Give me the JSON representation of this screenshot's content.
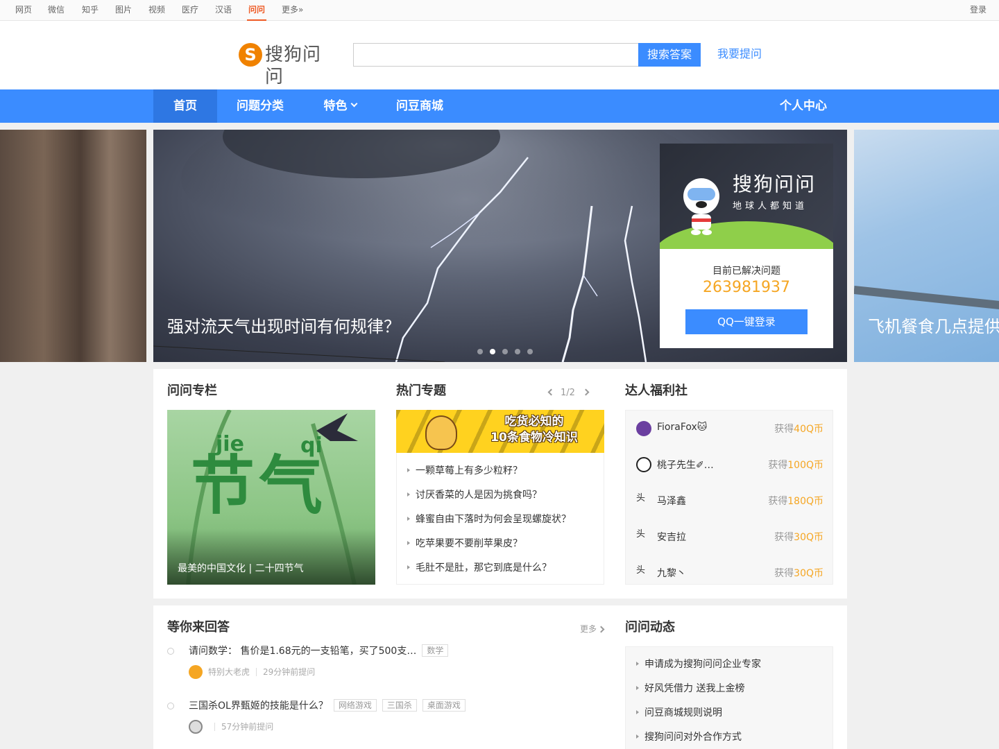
{
  "topbar": {
    "tabs": [
      "网页",
      "微信",
      "知乎",
      "图片",
      "视频",
      "医疗",
      "汉语",
      "问问",
      "更多»"
    ],
    "active_tab": "问问",
    "login": "登录"
  },
  "header": {
    "logo_text": "搜狗问问",
    "logo_mark": "S",
    "search_placeholder": "",
    "search_button": "搜索答案",
    "ask_link": "我要提问"
  },
  "nav": {
    "items": [
      "首页",
      "问题分类",
      "特色",
      "问豆商城"
    ],
    "right": "个人中心",
    "active": "首页"
  },
  "banner": {
    "caption": "强对流天气出现时间有何规律？",
    "next_caption": "飞机餐食几点提供",
    "slide_count": 5,
    "active_slide": 2
  },
  "login_card": {
    "brand": "搜狗问问",
    "slogan": "地球人都知道",
    "solved_label": "目前已解决问题",
    "solved_count": "263981937",
    "qq_button": "QQ一键登录"
  },
  "column": {
    "title": "问问专栏",
    "image_big_text": "节气",
    "pinyin_1": "jie",
    "pinyin_2": "qi",
    "caption": "最美的中国文化 | 二十四节气"
  },
  "hot": {
    "title": "热门专题",
    "pager": "1/2",
    "banner_title_1": "吃货必知的",
    "banner_title_2": "10条食物冷知识",
    "items": [
      "一颗草莓上有多少粒籽？",
      "讨厌香菜的人是因为挑食吗？",
      "蜂蜜自由下落时为何会呈现螺旋状？",
      "吃苹果要不要削苹果皮？",
      "毛肚不是肚，那它到底是什么？"
    ]
  },
  "daren": {
    "title": "达人福利社",
    "gain_prefix": "获得",
    "rows": [
      {
        "name": "FioraFox🐱",
        "amount": "40Q币",
        "avatar_color": "#6b3fa0",
        "broken": false
      },
      {
        "name": "桃子先生✐…",
        "amount": "100Q币",
        "avatar_color": "#222222",
        "broken": false
      },
      {
        "name": "马泽鑫",
        "amount": "180Q币",
        "avatar_text": "头",
        "broken": true
      },
      {
        "name": "安吉拉",
        "amount": "30Q币",
        "avatar_text": "头",
        "broken": true
      },
      {
        "name": "九黎丶",
        "amount": "30Q币",
        "avatar_text": "头",
        "broken": true
      }
    ]
  },
  "waiting": {
    "title": "等你来回答",
    "more": "更多",
    "questions": [
      {
        "text": "请问数学： 售价是1.68元的一支铅笔，买了500支…",
        "tags": [
          "数学"
        ],
        "user": "特别大老虎",
        "time": "29分钟前提问",
        "avatar_color": "#f5a623"
      },
      {
        "text": "三国杀OL界甄姬的技能是什么？",
        "tags": [
          "网络游戏",
          "三国杀",
          "桌面游戏"
        ],
        "user": "",
        "time": "57分钟前提问",
        "avatar_color": "#cccccc"
      }
    ]
  },
  "dynamics": {
    "title": "问问动态",
    "items": [
      "申请成为搜狗问问企业专家",
      "好风凭借力 送我上金榜",
      "问豆商城规则说明",
      "搜狗问问对外合作方式"
    ]
  },
  "colors": {
    "accent": "#3b8cff",
    "nav_active": "#2e77e3",
    "topbar_active": "#ee5a24",
    "gold": "#f5a623"
  }
}
